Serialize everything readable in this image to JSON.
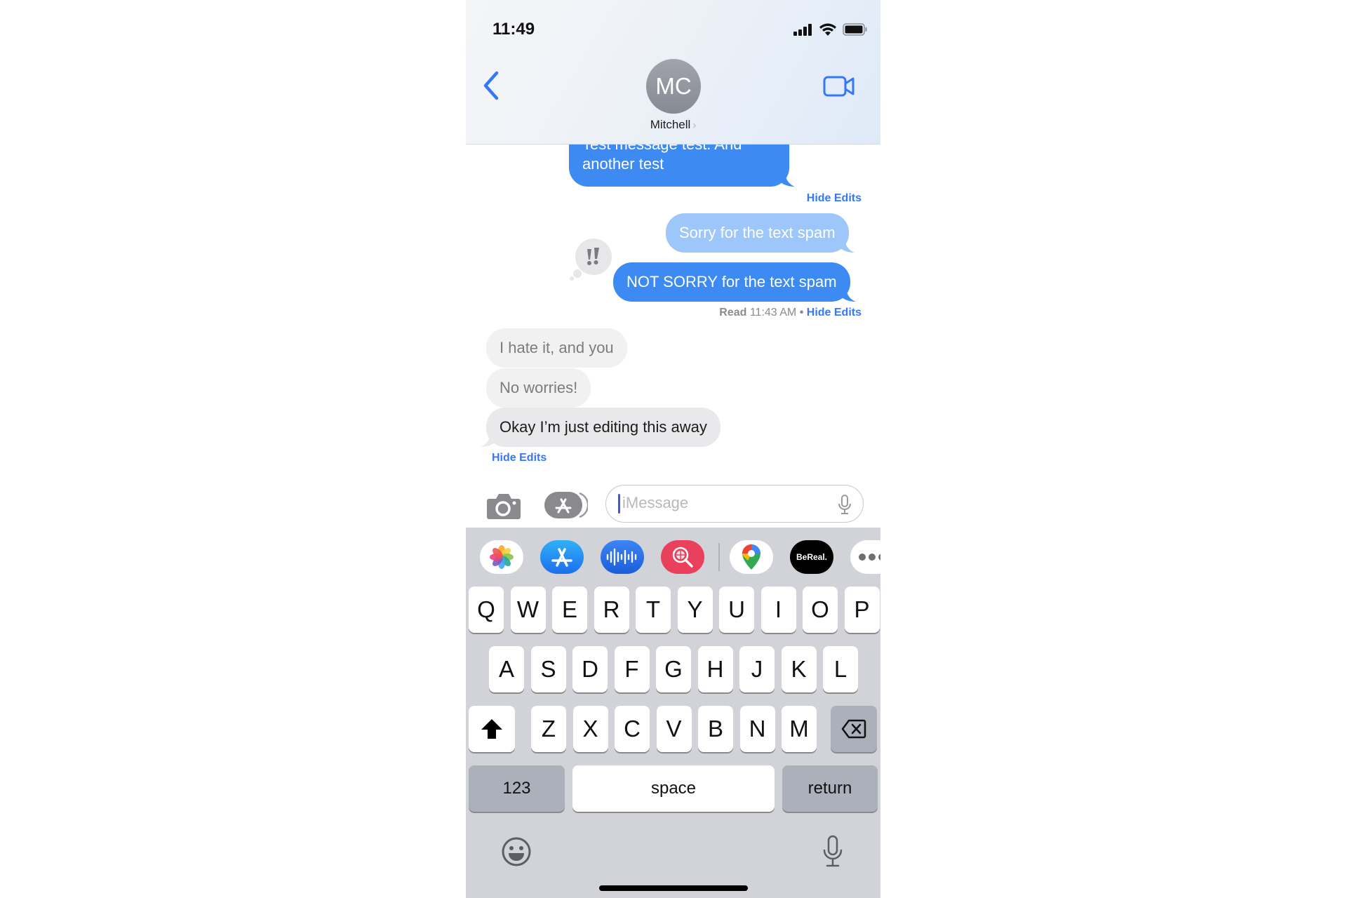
{
  "status_bar": {
    "time": "11:49",
    "icons": [
      "signal-icon",
      "wifi-icon",
      "battery-icon"
    ]
  },
  "header": {
    "back_icon": "chevron-left-icon",
    "avatar_initials": "MC",
    "contact_name": "Mitchell",
    "contact_chevron": "›",
    "video_icon": "video-camera-icon"
  },
  "colors": {
    "accent": "#3478f6",
    "sent_bubble": "#3d8bf2",
    "sent_bubble_faded": "#9dc6fa",
    "received_bubble": "#e9e9eb",
    "keyboard_bg": "#d1d3d9"
  },
  "messages": [
    {
      "direction": "sent",
      "text": "Test message test. And another test",
      "state": "edited"
    },
    {
      "direction": "meta",
      "link": "Hide Edits"
    },
    {
      "direction": "sent",
      "text": "Sorry for the text spam",
      "state": "previous-edit"
    },
    {
      "direction": "sent",
      "text": "NOT SORRY for the text spam",
      "state": "current",
      "tapback": "exclamation-icon"
    },
    {
      "direction": "meta",
      "read_label": "Read",
      "read_time": "11:43 AM",
      "separator": "•",
      "link": "Hide Edits"
    },
    {
      "direction": "received",
      "text": "I hate it, and you",
      "state": "previous-edit"
    },
    {
      "direction": "received",
      "text": "No worries!",
      "state": "previous-edit"
    },
    {
      "direction": "received",
      "text": "Okay I’m just editing this away",
      "state": "current"
    },
    {
      "direction": "meta",
      "link": "Hide Edits"
    }
  ],
  "composer": {
    "camera_icon": "camera-icon",
    "apps_icon": "app-store-icon",
    "placeholder": "iMessage",
    "value": "",
    "mic_icon": "microphone-icon"
  },
  "app_drawer": [
    {
      "name": "Photos",
      "icon": "photos-icon"
    },
    {
      "name": "App Store",
      "icon": "app-store-icon"
    },
    {
      "name": "Audio Message",
      "icon": "waveform-icon"
    },
    {
      "name": "Images Search",
      "icon": "globe-search-icon"
    },
    {
      "name": "Google Maps",
      "icon": "map-pin-icon"
    },
    {
      "name": "BeReal.",
      "icon": "bereal-icon",
      "label": "BeReal."
    },
    {
      "name": "More",
      "icon": "more-icon"
    }
  ],
  "keyboard": {
    "row1": [
      "Q",
      "W",
      "E",
      "R",
      "T",
      "Y",
      "U",
      "I",
      "O",
      "P"
    ],
    "row2": [
      "A",
      "S",
      "D",
      "F",
      "G",
      "H",
      "J",
      "K",
      "L"
    ],
    "row3": [
      "Z",
      "X",
      "C",
      "V",
      "B",
      "N",
      "M"
    ],
    "shift_icon": "shift-icon",
    "delete_icon": "delete-icon",
    "numbers_label": "123",
    "space_label": "space",
    "return_label": "return",
    "emoji_icon": "emoji-icon",
    "dictation_icon": "microphone-icon"
  }
}
